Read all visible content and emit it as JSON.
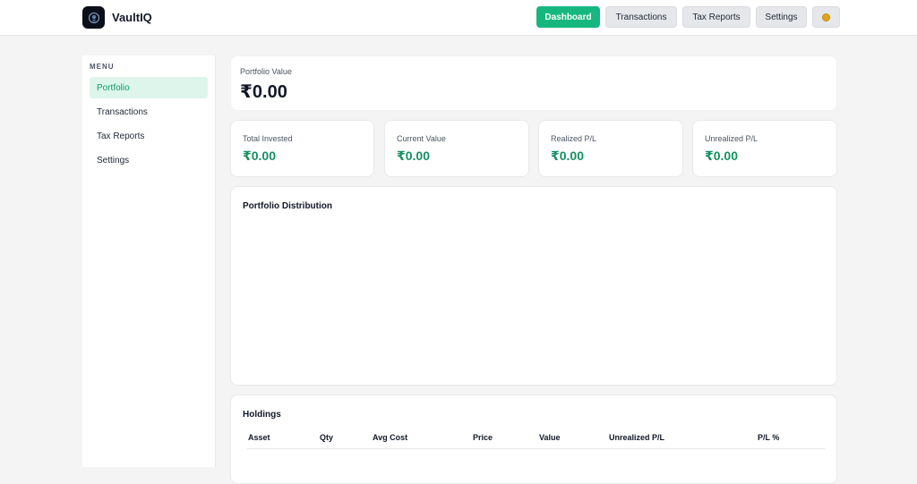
{
  "app": {
    "name": "VaultIQ",
    "logo_icon": "vault-logo-icon"
  },
  "topnav": {
    "items": [
      {
        "label": "Dashboard",
        "active": true
      },
      {
        "label": "Transactions",
        "active": false
      },
      {
        "label": "Tax Reports",
        "active": false
      },
      {
        "label": "Settings",
        "active": false
      }
    ],
    "theme_icon": "theme-toggle-icon"
  },
  "sidebar": {
    "menu_label": "MENU",
    "items": [
      {
        "label": "Portfolio",
        "active": true
      },
      {
        "label": "Transactions",
        "active": false
      },
      {
        "label": "Tax Reports",
        "active": false
      },
      {
        "label": "Settings",
        "active": false
      }
    ]
  },
  "portfolio_value": {
    "label": "Portfolio Value",
    "value": "₹0.00"
  },
  "stats": [
    {
      "label": "Total Invested",
      "value": "₹0.00"
    },
    {
      "label": "Current Value",
      "value": "₹0.00"
    },
    {
      "label": "Realized P/L",
      "value": "₹0.00"
    },
    {
      "label": "Unrealized P/L",
      "value": "₹0.00"
    }
  ],
  "distribution": {
    "title": "Portfolio Distribution"
  },
  "holdings": {
    "title": "Holdings",
    "columns": [
      "Asset",
      "Qty",
      "Avg Cost",
      "Price",
      "Value",
      "Unrealized P/L",
      "P/L %"
    ]
  },
  "colors": {
    "accent": "#16b77f",
    "positive": "#15915f",
    "active_bg": "#ddf5ea"
  }
}
